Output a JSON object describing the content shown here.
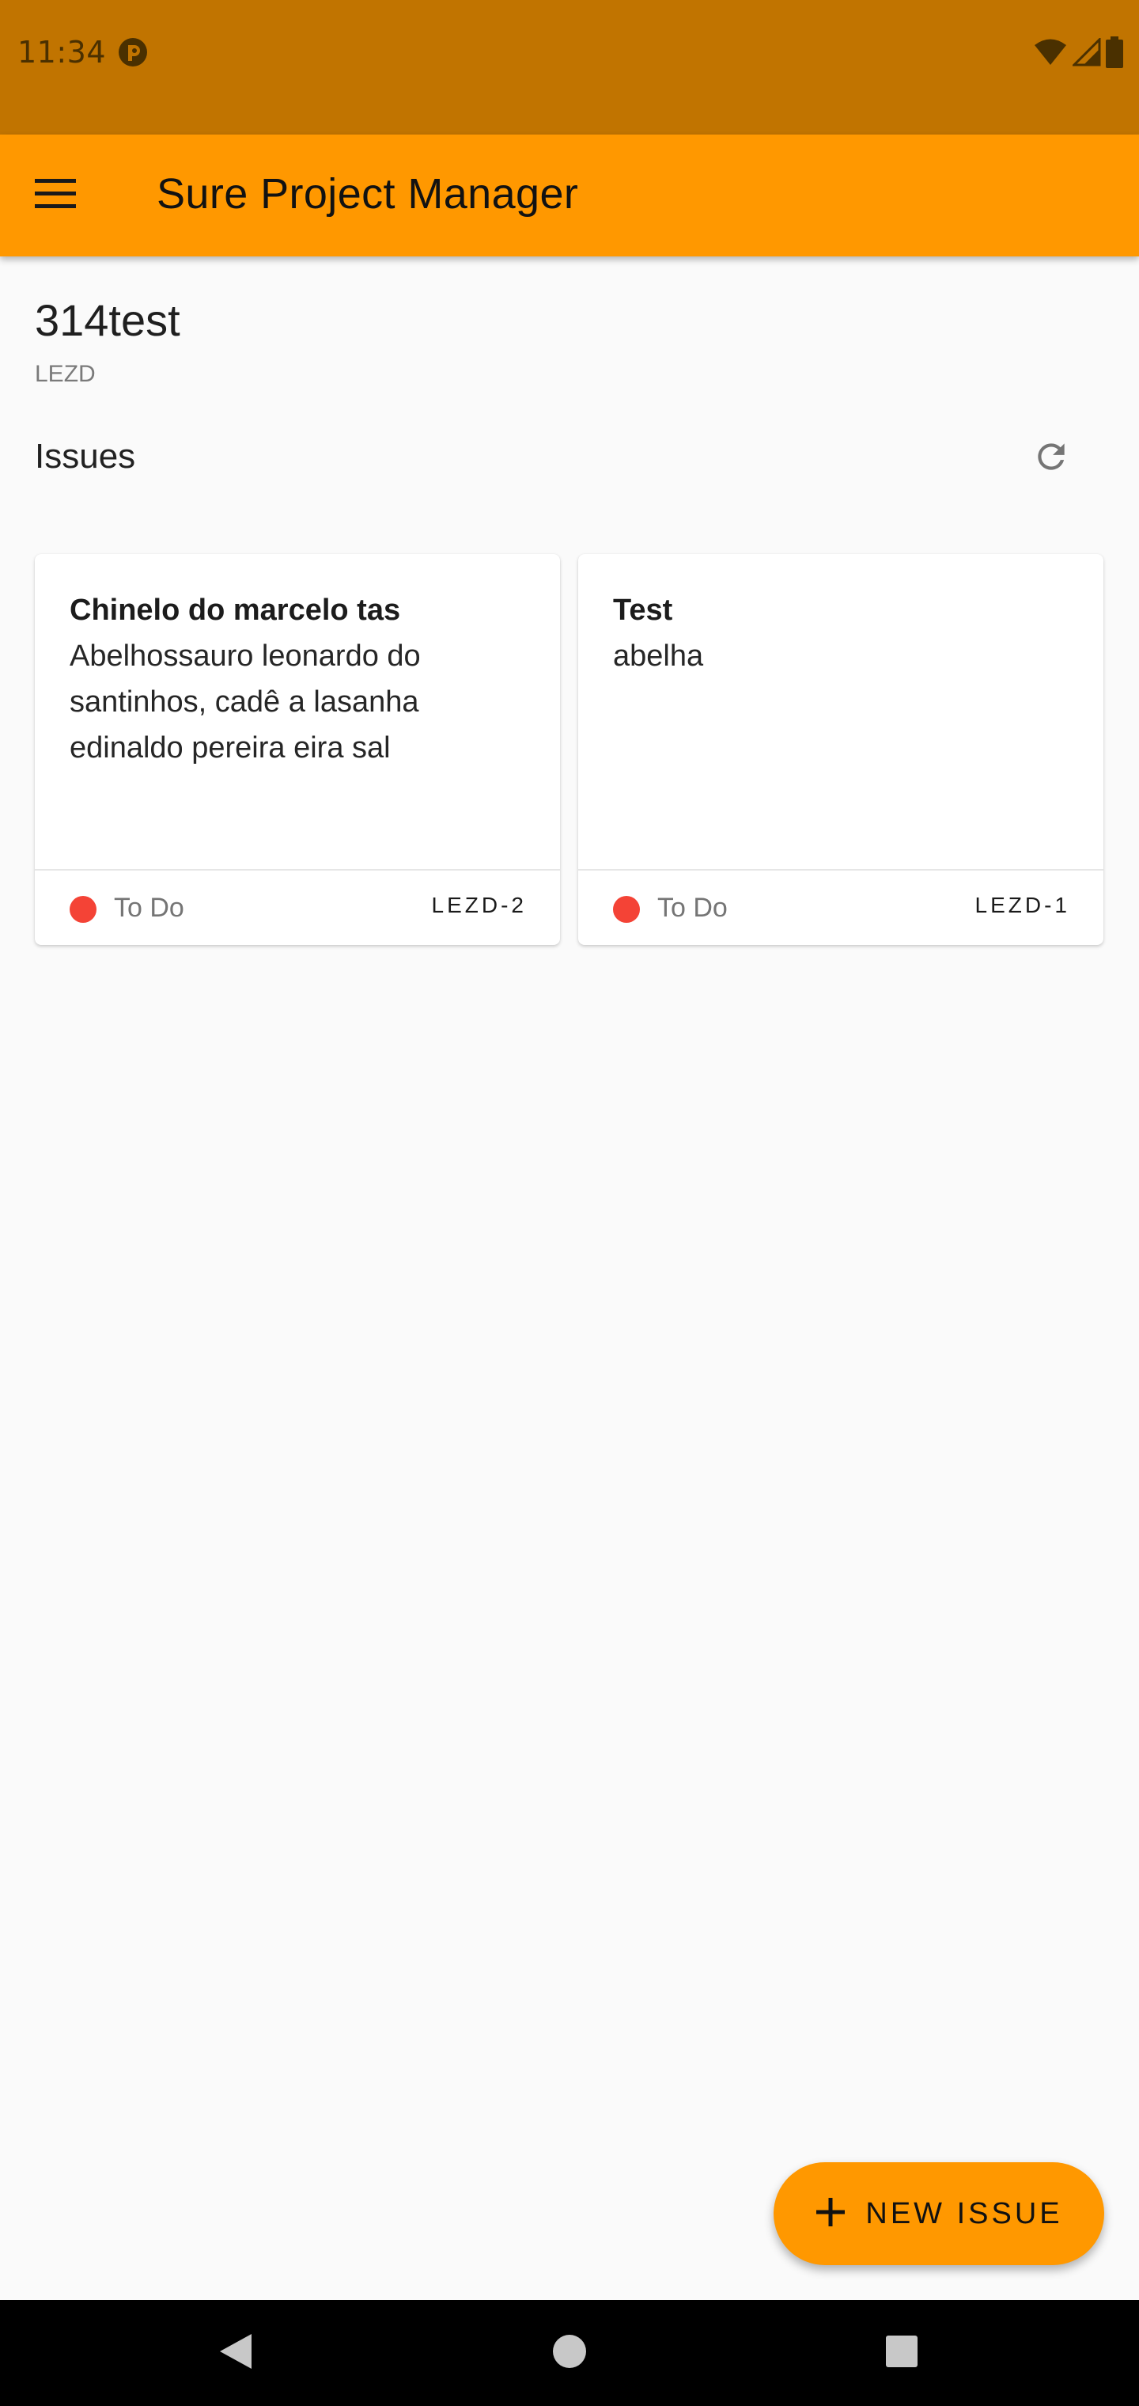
{
  "status_bar": {
    "time": "11:34",
    "icons": [
      "app-notification-icon",
      "wifi-icon",
      "cellular-signal-icon",
      "battery-icon"
    ]
  },
  "app_bar": {
    "title": "Sure Project Manager",
    "menu_icon": "menu-icon",
    "background": "#ff9800"
  },
  "project": {
    "name": "314test",
    "key": "LEZD"
  },
  "issues_section": {
    "title": "Issues",
    "refresh_icon": "refresh-icon"
  },
  "issues": [
    {
      "title": "Chinelo do marcelo tas",
      "description": "Abelhossauro leonardo do santinhos, cadê a lasanha edinaldo pereira eira sal",
      "status": "To Do",
      "status_color": "#f44336",
      "key": "LEZD-2"
    },
    {
      "title": "Test",
      "description": "abelha",
      "status": "To Do",
      "status_color": "#f44336",
      "key": "LEZD-1"
    }
  ],
  "fab": {
    "label": "NEW ISSUE",
    "icon": "plus-icon"
  },
  "nav_bar": {
    "icons": [
      "back-icon",
      "home-icon",
      "recents-icon"
    ]
  }
}
